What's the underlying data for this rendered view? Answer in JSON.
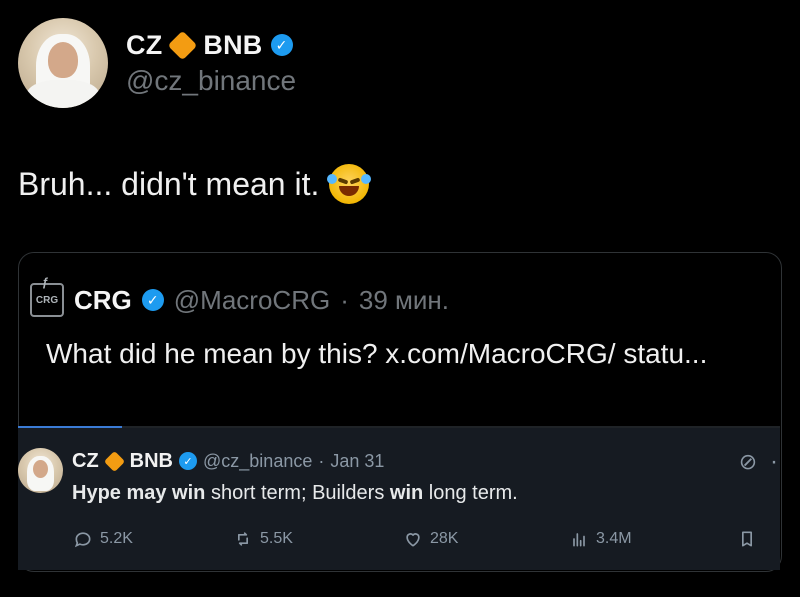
{
  "author": {
    "name_left": "CZ",
    "name_right": "BNB",
    "handle": "@cz_binance"
  },
  "tweet": {
    "text": "Bruh... didn't mean it."
  },
  "quote": {
    "account_name": "CRG",
    "handle": "@MacroCRG",
    "dot": "·",
    "time": "39 мин.",
    "text": "What did he mean by this? x.com/MacroCRG/ statu...",
    "logo_text": "CRG"
  },
  "embedded": {
    "name_left": "CZ",
    "name_right": "BNB",
    "handle": "@cz_binance",
    "dot": "·",
    "date": "Jan 31",
    "text_parts": {
      "p1": "Hype may win",
      "p2": " short term; Builders ",
      "p3": "win",
      "p4": " long term."
    },
    "metrics": {
      "replies": "5.2K",
      "retweets": "5.5K",
      "likes": "28K",
      "views": "3.4M"
    }
  },
  "icons": {
    "verified": "verified-badge-icon",
    "diamond": "bnb-diamond-icon",
    "emoji": "face-with-tears-of-joy-icon",
    "reply": "reply-icon",
    "retweet": "retweet-icon",
    "like": "heart-icon",
    "views": "views-icon",
    "bookmark": "bookmark-icon",
    "grok": "grok-icon"
  },
  "colors": {
    "background": "#000000",
    "text": "#e7e9ea",
    "muted": "#71767b",
    "accent": "#1d9bf0",
    "bnb": "#f39c12",
    "embedded_bg": "#161b22"
  }
}
